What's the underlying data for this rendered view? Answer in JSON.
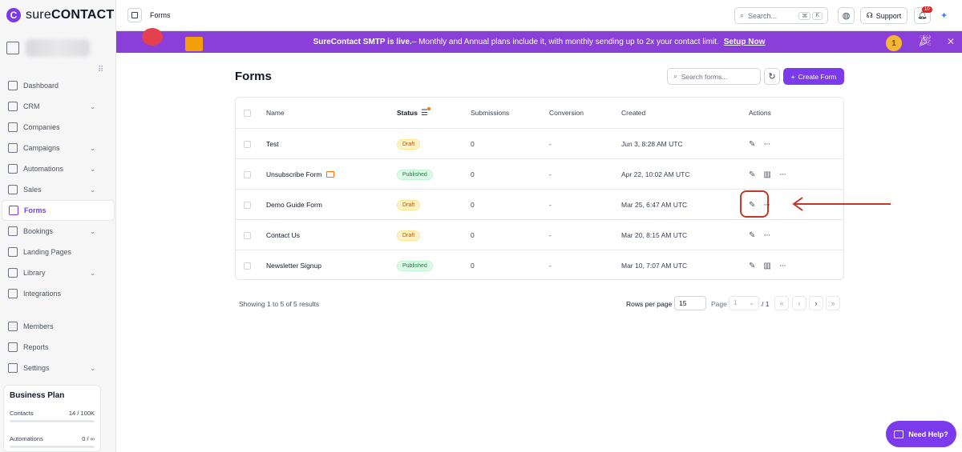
{
  "brand": {
    "name_light": "sure",
    "name_bold": "CONTACT",
    "logo_glyph": "C",
    "accent": "#7c3aed"
  },
  "sidebar": {
    "items": [
      {
        "label": "Dashboard",
        "icon": "dashboard-icon",
        "chevron": false,
        "active": false
      },
      {
        "label": "CRM",
        "icon": "crm-icon",
        "chevron": true,
        "active": false
      },
      {
        "label": "Companies",
        "icon": "building-icon",
        "chevron": false,
        "active": false
      },
      {
        "label": "Campaigns",
        "icon": "megaphone-icon",
        "chevron": true,
        "active": false
      },
      {
        "label": "Automations",
        "icon": "workflow-icon",
        "chevron": true,
        "active": false
      },
      {
        "label": "Sales",
        "icon": "briefcase-icon",
        "chevron": true,
        "active": false
      },
      {
        "label": "Forms",
        "icon": "forms-icon",
        "chevron": false,
        "active": true
      },
      {
        "label": "Bookings",
        "icon": "calendar-icon",
        "chevron": true,
        "active": false
      },
      {
        "label": "Landing Pages",
        "icon": "landing-page-icon",
        "chevron": false,
        "active": false
      },
      {
        "label": "Library",
        "icon": "library-icon",
        "chevron": true,
        "active": false
      },
      {
        "label": "Integrations",
        "icon": "integrations-icon",
        "chevron": false,
        "active": false
      }
    ],
    "bottom_items": [
      {
        "label": "Members",
        "icon": "users-icon",
        "chevron": false
      },
      {
        "label": "Reports",
        "icon": "chart-icon",
        "chevron": false
      },
      {
        "label": "Settings",
        "icon": "gear-icon",
        "chevron": true
      }
    ],
    "plan": {
      "title": "Business Plan",
      "contacts_label": "Contacts",
      "contacts_value": "14 / 100K",
      "automations_label": "Automations",
      "automations_value": "0 / ∞"
    }
  },
  "topbar": {
    "breadcrumb": "Forms",
    "search_placeholder": "Search...",
    "shortcut_cmd": "⌘",
    "shortcut_key": "K",
    "support_label": "Support",
    "notification_count": "10"
  },
  "banner": {
    "bold": "SureContact SMTP is live.",
    "text": " – Monthly and Annual plans include it, with monthly sending up to 2x your contact limit.",
    "link": "Setup Now",
    "medal_text": "1",
    "color": "#8b3fd9"
  },
  "page": {
    "title": "Forms",
    "search_placeholder": "Search forms...",
    "create_label": "Create Form"
  },
  "table": {
    "headers": {
      "name": "Name",
      "status": "Status",
      "submissions": "Submissions",
      "conversion": "Conversion",
      "created": "Created",
      "actions": "Actions"
    },
    "rows": [
      {
        "name": "Test",
        "status": "Draft",
        "submissions": "0",
        "conversion": "-",
        "created": "Jun 3, 8:28 AM UTC",
        "mail_icon": false,
        "report_icon": false
      },
      {
        "name": "Unsubscribe Form",
        "status": "Published",
        "submissions": "0",
        "conversion": "-",
        "created": "Apr 22, 10:02 AM UTC",
        "mail_icon": true,
        "report_icon": true
      },
      {
        "name": "Demo Guide Form",
        "status": "Draft",
        "submissions": "0",
        "conversion": "-",
        "created": "Mar 25, 6:47 AM UTC",
        "mail_icon": false,
        "report_icon": false
      },
      {
        "name": "Contact Us",
        "status": "Draft",
        "submissions": "0",
        "conversion": "-",
        "created": "Mar 20, 8:15 AM UTC",
        "mail_icon": false,
        "report_icon": false
      },
      {
        "name": "Newsletter Signup",
        "status": "Published",
        "submissions": "0",
        "conversion": "-",
        "created": "Mar 10, 7:07 AM UTC",
        "mail_icon": false,
        "report_icon": true
      }
    ]
  },
  "pagination": {
    "showing": "Showing 1 to 5 of 5 results",
    "rows_label": "Rows per page",
    "rows_value": "15",
    "page_label": "Page",
    "page_value": "1",
    "page_total": "/ 1",
    "first": "«",
    "prev": "‹",
    "next": "›",
    "last": "»"
  },
  "help": {
    "label": "Need Help?"
  },
  "annotation": {
    "color": "#c0392b"
  }
}
